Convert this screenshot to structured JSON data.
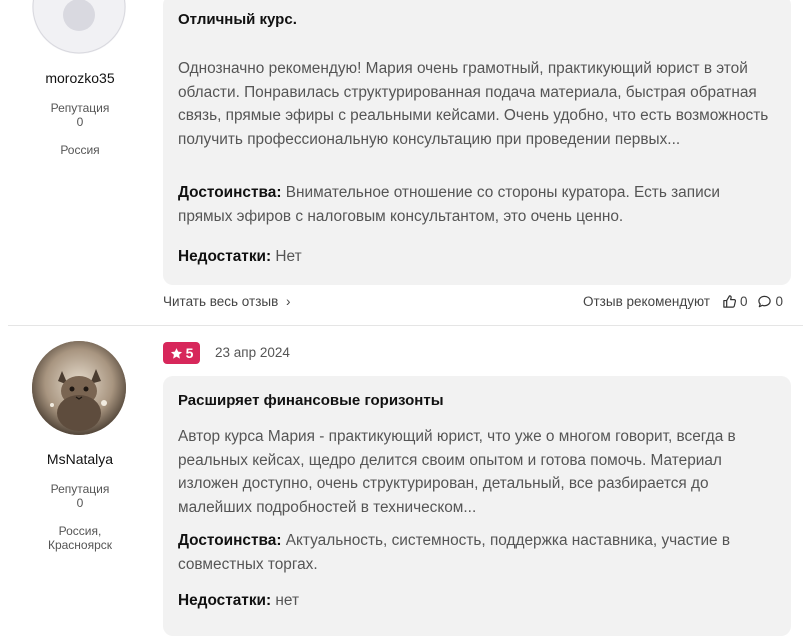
{
  "reviews": [
    {
      "author": {
        "name": "morozko35",
        "reputation_label": "Репутация",
        "reputation_value": "0",
        "location": "Россия"
      },
      "title": "Отличный курс.",
      "text": "Однозначно рекомендую! Мария очень грамотный, практикующий юрист в этой области. Понравилась структурированная подача материала, быстрая обратная связь, прямые эфиры с реальными кейсами. Очень удобно, что есть возможность получить профессиональную консультацию при проведении первых...",
      "pros_label": "Достоинства:",
      "pros": "Внимательное отношение со стороны куратора. Есть записи прямых эфиров с налоговым консультантом, это очень ценно.",
      "cons_label": "Недостатки:",
      "cons": "Нет",
      "read_more": "Читать весь отзыв",
      "recommend_label": "Отзыв рекомендуют",
      "likes": "0",
      "comments": "0"
    },
    {
      "author": {
        "name": "MsNatalya",
        "reputation_label": "Репутация",
        "reputation_value": "0",
        "location_line1": "Россия,",
        "location_line2": "Красноярск"
      },
      "rating": "5",
      "date": "23 апр 2024",
      "title": "Расширяет финансовые горизонты",
      "text": "Автор курса Мария - практикующий юрист, что уже о многом говорит, всегда в реальных кейсах, щедро делится своим опытом и готова помочь. Материал изложен доступно, очень структурирован, детальный, все разбирается до малейших подробностей в техническом...",
      "pros_label": "Достоинства:",
      "pros": "Актуальность, системность, поддержка наставника, участие в совместных торгах.",
      "cons_label": "Недостатки:",
      "cons": "нет"
    }
  ],
  "colors": {
    "rating_badge": "#d7275b",
    "card_bg": "#f2f2f2"
  }
}
